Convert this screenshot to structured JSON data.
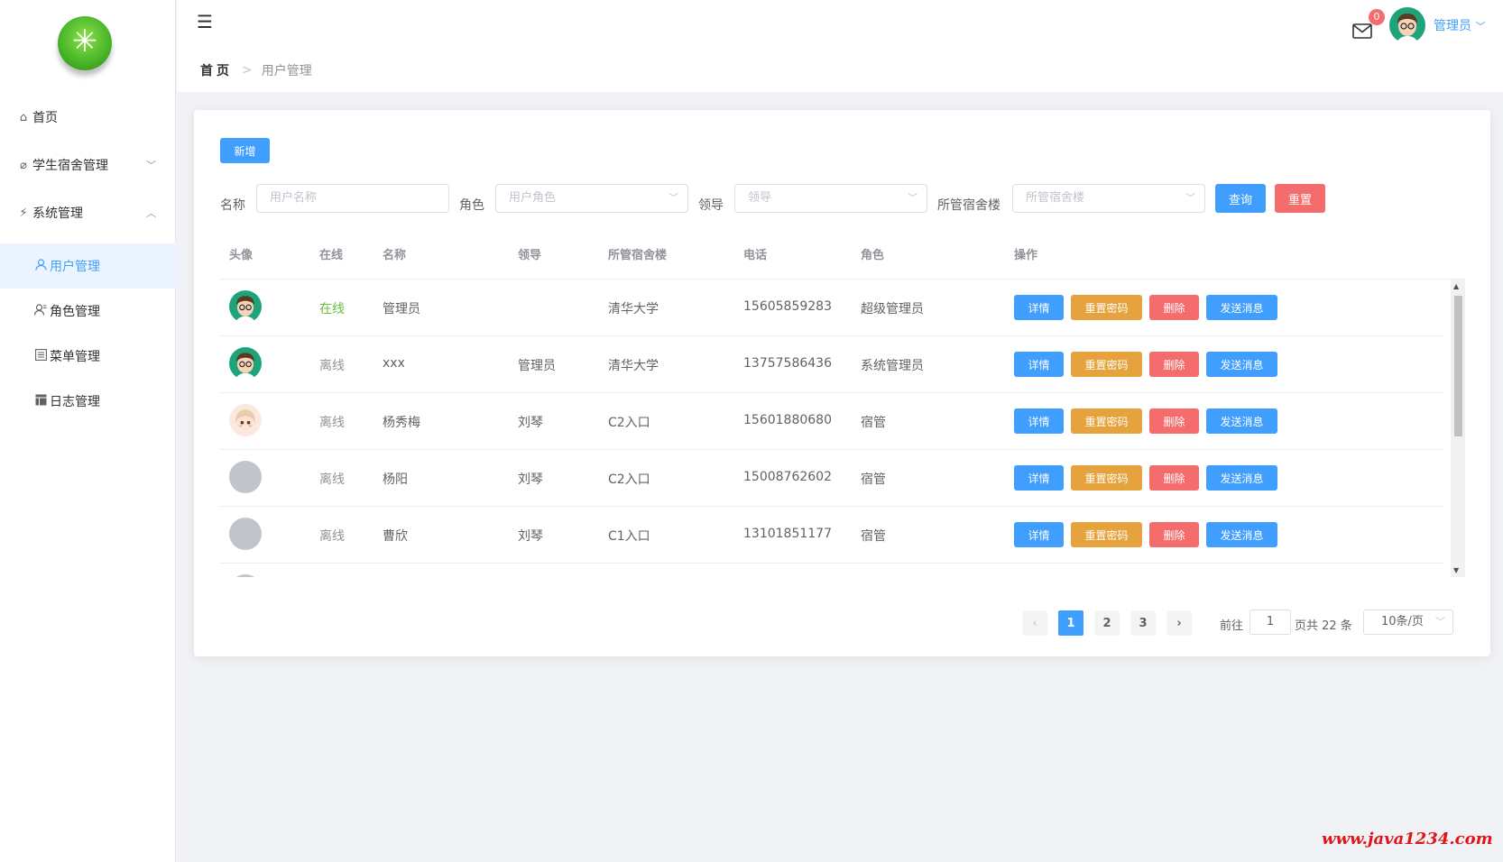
{
  "sidebar": {
    "items": [
      {
        "label": "首页",
        "icon": "home-icon"
      },
      {
        "label": "学生宿舍管理",
        "icon": "paperclip-icon",
        "chevron": "﹀"
      },
      {
        "label": "系统管理",
        "icon": "lightning-icon",
        "chevron": "︿"
      },
      {
        "label": "用户管理",
        "icon": "user-icon",
        "active": true
      },
      {
        "label": "角色管理",
        "icon": "role-icon"
      },
      {
        "label": "菜单管理",
        "icon": "menu-list-icon"
      },
      {
        "label": "日志管理",
        "icon": "log-table-icon"
      }
    ]
  },
  "header": {
    "breadcrumb": {
      "home": "首页",
      "separator": ">",
      "current": "用户管理"
    },
    "mail_badge": "0",
    "user_name": "管理员",
    "user_chevron": "﹀"
  },
  "toolbar": {
    "add_label": "新增"
  },
  "filters": {
    "name_label": "名称",
    "name_placeholder": "用户名称",
    "role_label": "角色",
    "role_placeholder": "用户角色",
    "leader_label": "领导",
    "leader_placeholder": "领导",
    "building_label": "所管宿舍楼",
    "building_placeholder": "所管宿舍楼",
    "query_label": "查询",
    "reset_label": "重置"
  },
  "table": {
    "headers": [
      "头像",
      "在线",
      "名称",
      "领导",
      "所管宿舍楼",
      "电话",
      "角色",
      "操作"
    ],
    "rows": [
      {
        "avatar": "boy",
        "online": "在线",
        "name": "管理员",
        "leader": "",
        "building": "清华大学",
        "phone": "15605859283",
        "role": "超级管理员"
      },
      {
        "avatar": "boy",
        "online": "离线",
        "name": "xxx",
        "leader": "管理员",
        "building": "清华大学",
        "phone": "13757586436",
        "role": "系统管理员"
      },
      {
        "avatar": "girl",
        "online": "离线",
        "name": "杨秀梅",
        "leader": "刘琴",
        "building": "C2入口",
        "phone": "15601880680",
        "role": "宿管"
      },
      {
        "avatar": "blank",
        "online": "离线",
        "name": "杨阳",
        "leader": "刘琴",
        "building": "C2入口",
        "phone": "15008762602",
        "role": "宿管"
      },
      {
        "avatar": "blank",
        "online": "离线",
        "name": "曹欣",
        "leader": "刘琴",
        "building": "C1入口",
        "phone": "13101851177",
        "role": "宿管"
      }
    ],
    "actions": {
      "detail": "详情",
      "reset_pwd": "重置密码",
      "delete": "删除",
      "send_msg": "发送消息"
    }
  },
  "pagination": {
    "pages": [
      "1",
      "2",
      "3"
    ],
    "current_page": "1",
    "prev": "‹",
    "next": "›",
    "goto_label": "前往",
    "goto_value": "1",
    "total_text": "页共 22 条",
    "page_size": "10条/页"
  },
  "watermark": "www.java1234.com",
  "colors": {
    "primary": "#409eff",
    "warning": "#e6a23c",
    "danger": "#f56c6c",
    "success": "#67c23a"
  }
}
